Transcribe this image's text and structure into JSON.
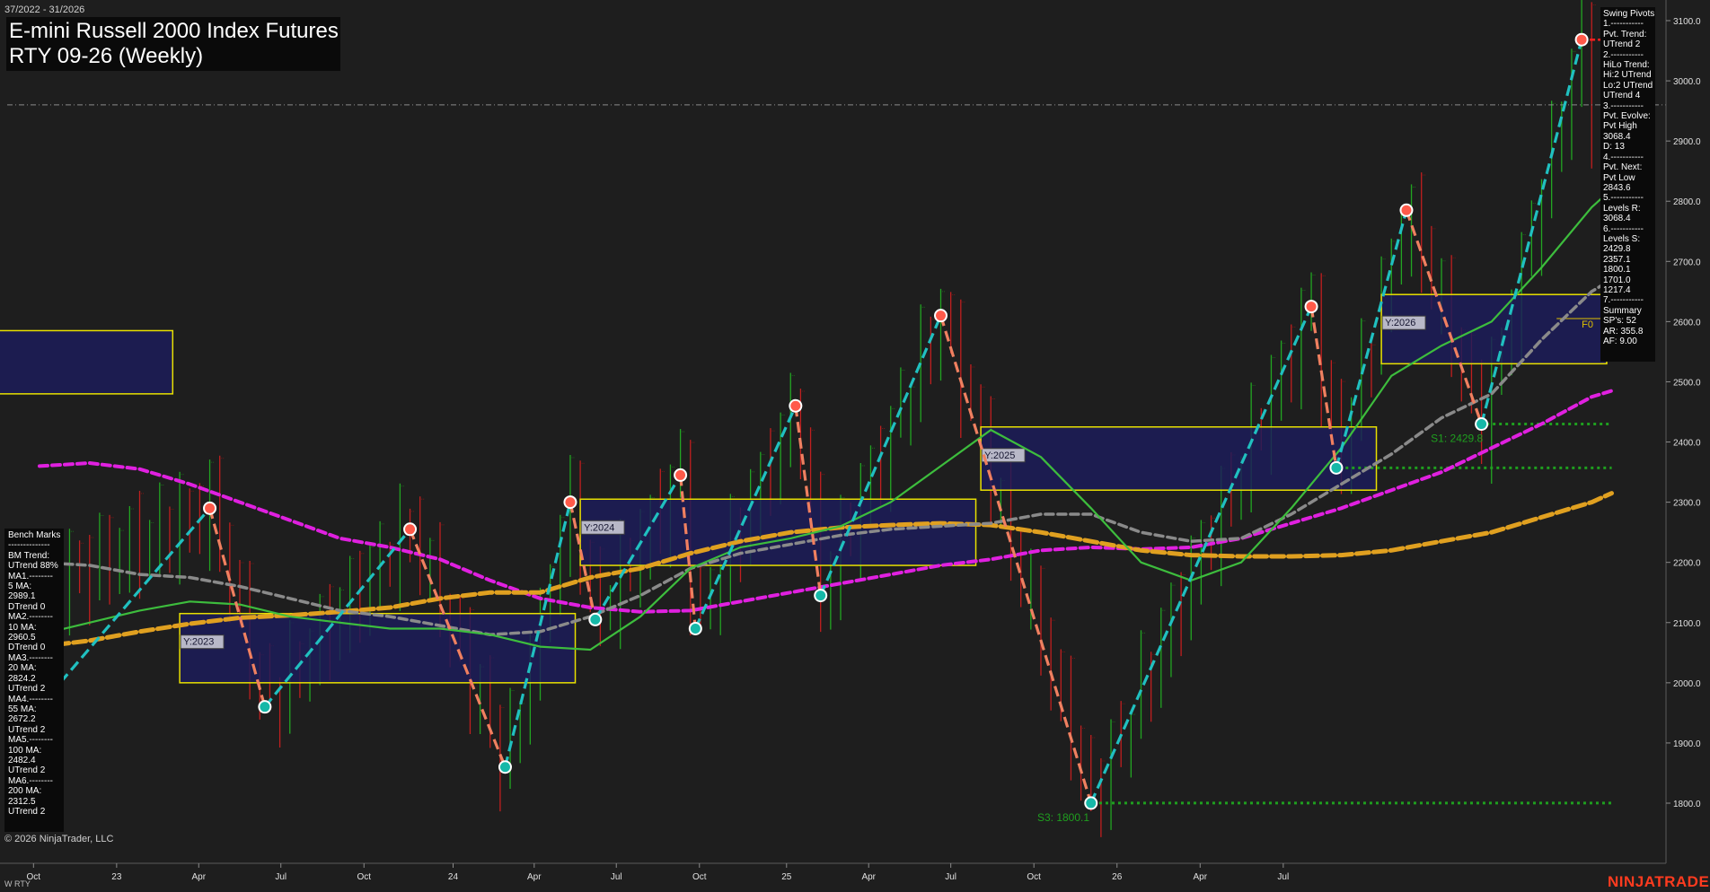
{
  "header": {
    "date_range": "37/2022 - 31/2026",
    "title_line1": "E-mini Russell 2000 Index Futures",
    "title_line2": "RTY 09-26 (Weekly)"
  },
  "footer": {
    "copyright": "© 2026 NinjaTrader, LLC",
    "instrument_tag": "W RTY",
    "brand": "NINJATRADER"
  },
  "swing_pivots_panel": [
    "Swing Pivots",
    "1.-----------",
    "Pvt. Trend:",
    "UTrend 2",
    "2.-----------",
    "HiLo Trend:",
    "Hi:2 UTrend",
    "Lo:2 UTrend",
    "UTrend 4",
    "3.-----------",
    "Pvt. Evolve:",
    "Pvt High",
    "3068.4",
    "D: 13",
    "4.-----------",
    "Pvt. Next:",
    "Pvt Low",
    "2843.6",
    "5.-----------",
    "Levels R:",
    "3068.4",
    "6.-----------",
    "Levels S:",
    "2429.8",
    "2357.1",
    "1800.1",
    "1701.0",
    "1217.4",
    "7.-----------",
    "Summary",
    "SP's: 52",
    "AR: 355.8",
    "AF: 9.00"
  ],
  "bench_marks_panel": [
    "Bench Marks",
    "--------------",
    "BM Trend:",
    "UTrend 88%",
    "MA1.--------",
    "5 MA:",
    "2989.1",
    "DTrend 0",
    "MA2.--------",
    "10 MA:",
    "2960.5",
    "DTrend 0",
    "MA3.--------",
    "20 MA:",
    "2824.2",
    "UTrend 2",
    "MA4.--------",
    "55 MA:",
    "2672.2",
    "UTrend 2",
    "MA5.--------",
    "100 MA:",
    "2482.4",
    "UTrend 2",
    "MA6.--------",
    "200 MA:",
    "2312.5",
    "UTrend 2"
  ],
  "colors": {
    "background": "#1e1e1e",
    "grid": "#2c2c2c",
    "ma_green": "#3dbd3d",
    "ma_gray": "#8a8a8a",
    "ma_orange": "#e0a020",
    "ma_magenta": "#e020e0",
    "swing_up": "#20c0c0",
    "swing_down": "#f08060",
    "box_fill": "#1c1c5c",
    "box_border": "#e8e000",
    "support": "#1f9f1f",
    "pivot_high": "#ff5a4a",
    "pivot_low": "#16b8a8"
  },
  "chart_data": {
    "type": "candlestick",
    "title": "E-mini Russell 2000 Index Futures RTY 09-26 (Weekly)",
    "x_ticks": [
      "Oct",
      "23",
      "Apr",
      "Jul",
      "Oct",
      "24",
      "Apr",
      "Jul",
      "Oct",
      "25",
      "Apr",
      "Jul",
      "Oct",
      "26",
      "Apr",
      "Jul"
    ],
    "y_ticks": [
      "3100.0",
      "3000.0",
      "2900.0",
      "2800.0",
      "2700.0",
      "2600.0",
      "2500.0",
      "2400.0",
      "2300.0",
      "2200.0",
      "2100.0",
      "2000.0",
      "1900.0",
      "1800.0"
    ],
    "ylim": [
      1700,
      3130
    ],
    "reference_line": 2960,
    "swing_pivots": [
      {
        "x": 17.0,
        "y": 2290,
        "type": "high"
      },
      {
        "x": 22.5,
        "y": 1960,
        "type": "low"
      },
      {
        "x": 37.0,
        "y": 2255,
        "type": "high"
      },
      {
        "x": 46.5,
        "y": 1860,
        "type": "low"
      },
      {
        "x": 53.0,
        "y": 2300,
        "type": "high"
      },
      {
        "x": 55.5,
        "y": 2105,
        "type": "low"
      },
      {
        "x": 64.0,
        "y": 2345,
        "type": "high"
      },
      {
        "x": 65.5,
        "y": 2090,
        "type": "low"
      },
      {
        "x": 75.5,
        "y": 2460,
        "type": "high"
      },
      {
        "x": 78.0,
        "y": 2145,
        "type": "low"
      },
      {
        "x": 90.0,
        "y": 2610,
        "type": "high"
      },
      {
        "x": 105.0,
        "y": 1800.1,
        "type": "low"
      },
      {
        "x": 127.0,
        "y": 2625,
        "type": "high"
      },
      {
        "x": 129.5,
        "y": 2357.1,
        "type": "low"
      },
      {
        "x": 136.5,
        "y": 2785,
        "type": "high"
      },
      {
        "x": 144.0,
        "y": 2429.8,
        "type": "low"
      },
      {
        "x": 154.0,
        "y": 3068.4,
        "type": "high"
      }
    ],
    "year_boxes": [
      {
        "label": "Y:2023",
        "x0": 14,
        "x1": 53.5,
        "y0": 2000,
        "y1": 2115
      },
      {
        "label": "Y:2024",
        "x0": 54,
        "x1": 93.5,
        "y0": 2195,
        "y1": 2305
      },
      {
        "label": "Y:2025",
        "x0": 94,
        "x1": 133.5,
        "y0": 2320,
        "y1": 2425
      },
      {
        "label": "Y:2026",
        "x0": 134,
        "x1": 156.5,
        "y0": 2530,
        "y1": 2645
      },
      {
        "label": "",
        "x0": -20,
        "x1": 13.3,
        "y0": 2480,
        "y1": 2585
      }
    ],
    "support_levels": [
      {
        "label": "S1: 2429.8",
        "y": 2429.8,
        "x0": 144.5
      },
      {
        "label": "",
        "y": 2357.1,
        "x0": 129.8
      },
      {
        "label": "S3: 1800.1",
        "y": 1800.1,
        "x0": 105.2
      }
    ],
    "resistance_level": {
      "y": 3068.4
    },
    "annotations": [
      {
        "text": "F0",
        "x": 154,
        "y": 2590
      }
    ],
    "series": [
      {
        "name": "MA 200",
        "color": "magenta",
        "points": [
          [
            0,
            2360
          ],
          [
            5,
            2365
          ],
          [
            10,
            2355
          ],
          [
            15,
            2330
          ],
          [
            20,
            2300
          ],
          [
            25,
            2270
          ],
          [
            30,
            2240
          ],
          [
            35,
            2225
          ],
          [
            40,
            2205
          ],
          [
            45,
            2170
          ],
          [
            50,
            2140
          ],
          [
            55,
            2125
          ],
          [
            60,
            2118
          ],
          [
            65,
            2120
          ],
          [
            70,
            2135
          ],
          [
            75,
            2150
          ],
          [
            80,
            2165
          ],
          [
            85,
            2180
          ],
          [
            90,
            2195
          ],
          [
            95,
            2205
          ],
          [
            100,
            2220
          ],
          [
            105,
            2225
          ],
          [
            110,
            2222
          ],
          [
            115,
            2225
          ],
          [
            120,
            2240
          ],
          [
            125,
            2265
          ],
          [
            130,
            2290
          ],
          [
            135,
            2320
          ],
          [
            140,
            2350
          ],
          [
            145,
            2390
          ],
          [
            150,
            2430
          ],
          [
            155,
            2475
          ],
          [
            157,
            2485
          ]
        ]
      },
      {
        "name": "MA 100",
        "color": "orange",
        "points": [
          [
            0,
            2060
          ],
          [
            5,
            2070
          ],
          [
            10,
            2085
          ],
          [
            15,
            2098
          ],
          [
            20,
            2108
          ],
          [
            25,
            2112
          ],
          [
            30,
            2118
          ],
          [
            35,
            2125
          ],
          [
            40,
            2140
          ],
          [
            45,
            2150
          ],
          [
            50,
            2150
          ],
          [
            55,
            2175
          ],
          [
            60,
            2190
          ],
          [
            65,
            2215
          ],
          [
            70,
            2235
          ],
          [
            75,
            2250
          ],
          [
            80,
            2258
          ],
          [
            85,
            2262
          ],
          [
            90,
            2265
          ],
          [
            95,
            2262
          ],
          [
            100,
            2250
          ],
          [
            105,
            2235
          ],
          [
            110,
            2220
          ],
          [
            115,
            2212
          ],
          [
            120,
            2210
          ],
          [
            125,
            2210
          ],
          [
            130,
            2212
          ],
          [
            135,
            2220
          ],
          [
            140,
            2235
          ],
          [
            145,
            2250
          ],
          [
            150,
            2275
          ],
          [
            155,
            2300
          ],
          [
            157,
            2315
          ]
        ]
      },
      {
        "name": "MA 55",
        "color": "gray",
        "points": [
          [
            0,
            2200
          ],
          [
            5,
            2195
          ],
          [
            10,
            2180
          ],
          [
            15,
            2175
          ],
          [
            20,
            2160
          ],
          [
            25,
            2140
          ],
          [
            30,
            2120
          ],
          [
            35,
            2110
          ],
          [
            40,
            2095
          ],
          [
            45,
            2080
          ],
          [
            50,
            2085
          ],
          [
            55,
            2110
          ],
          [
            60,
            2145
          ],
          [
            65,
            2190
          ],
          [
            70,
            2215
          ],
          [
            75,
            2230
          ],
          [
            80,
            2245
          ],
          [
            85,
            2255
          ],
          [
            90,
            2260
          ],
          [
            95,
            2265
          ],
          [
            100,
            2280
          ],
          [
            105,
            2280
          ],
          [
            110,
            2250
          ],
          [
            115,
            2235
          ],
          [
            120,
            2240
          ],
          [
            125,
            2280
          ],
          [
            130,
            2330
          ],
          [
            135,
            2380
          ],
          [
            140,
            2440
          ],
          [
            145,
            2480
          ],
          [
            150,
            2570
          ],
          [
            155,
            2650
          ],
          [
            157,
            2670
          ]
        ]
      },
      {
        "name": "MA 20",
        "color": "green",
        "points": [
          [
            0,
            2080
          ],
          [
            5,
            2100
          ],
          [
            10,
            2120
          ],
          [
            15,
            2135
          ],
          [
            20,
            2130
          ],
          [
            25,
            2110
          ],
          [
            30,
            2100
          ],
          [
            35,
            2090
          ],
          [
            40,
            2090
          ],
          [
            45,
            2080
          ],
          [
            50,
            2060
          ],
          [
            55,
            2055
          ],
          [
            60,
            2110
          ],
          [
            65,
            2190
          ],
          [
            70,
            2225
          ],
          [
            75,
            2240
          ],
          [
            80,
            2260
          ],
          [
            85,
            2300
          ],
          [
            90,
            2360
          ],
          [
            95,
            2420
          ],
          [
            100,
            2375
          ],
          [
            105,
            2290
          ],
          [
            110,
            2200
          ],
          [
            115,
            2170
          ],
          [
            120,
            2200
          ],
          [
            125,
            2290
          ],
          [
            130,
            2390
          ],
          [
            135,
            2510
          ],
          [
            140,
            2560
          ],
          [
            145,
            2600
          ],
          [
            150,
            2690
          ],
          [
            155,
            2790
          ],
          [
            157,
            2820
          ]
        ]
      }
    ]
  }
}
